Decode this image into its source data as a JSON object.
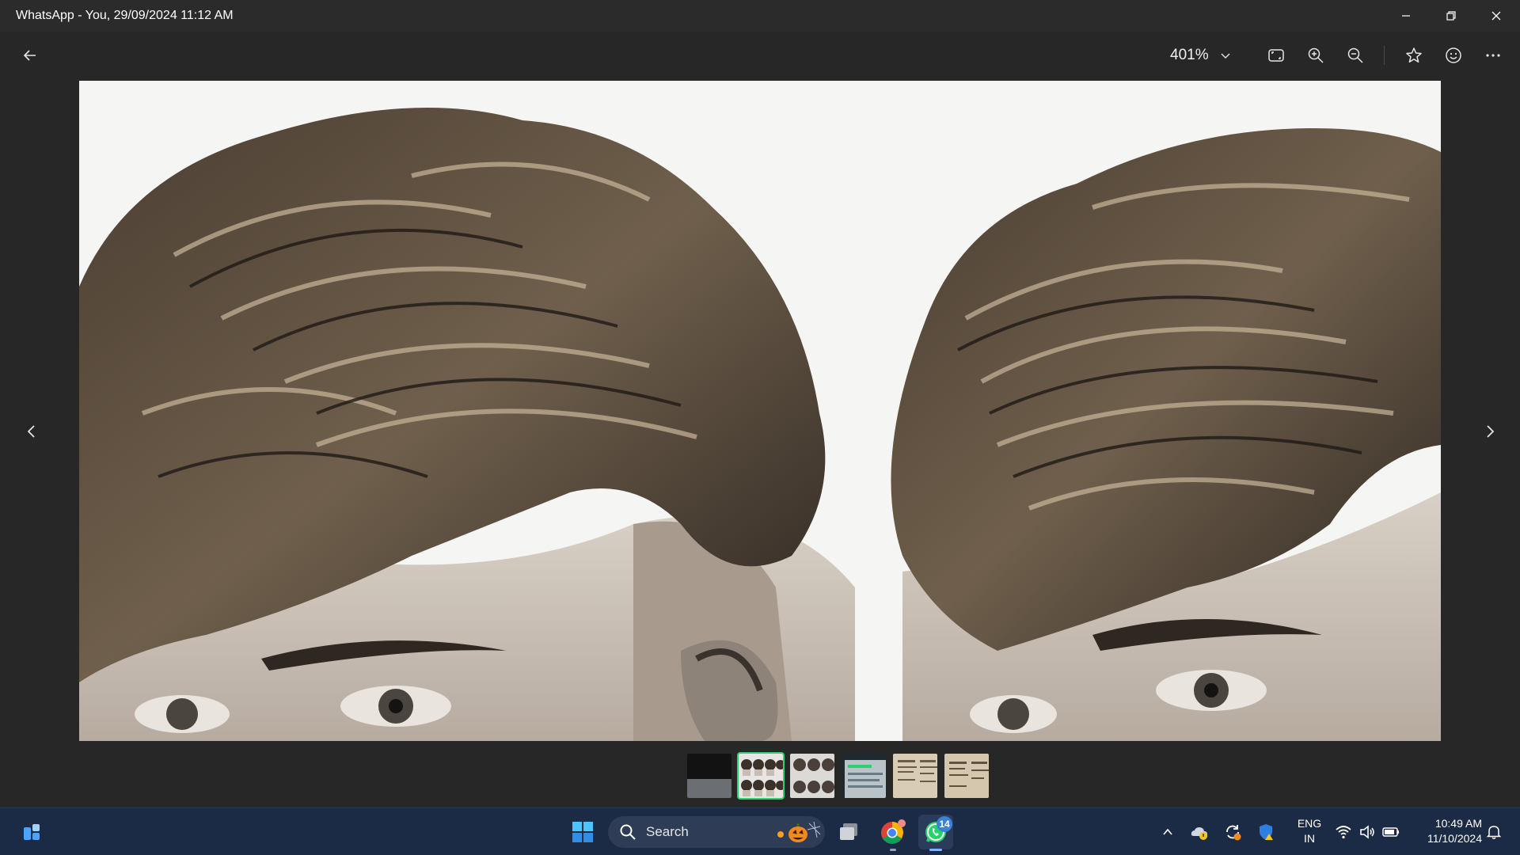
{
  "window": {
    "title": "WhatsApp - You, 29/09/2024 11:12 AM"
  },
  "toolbar": {
    "zoom_level": "401%"
  },
  "filmstrip": {
    "count": 6,
    "active_index": 1
  },
  "taskbar": {
    "search_label": "Search",
    "whatsapp_badge": "14",
    "language_line1": "ENG",
    "language_line2": "IN",
    "time": "10:49 AM",
    "date": "11/10/2024"
  },
  "colors": {
    "accent_green": "#2fcf73",
    "taskbar_bg": "#1c2b45",
    "viewer_bg": "#272727",
    "badge_blue": "#3b82d6"
  }
}
